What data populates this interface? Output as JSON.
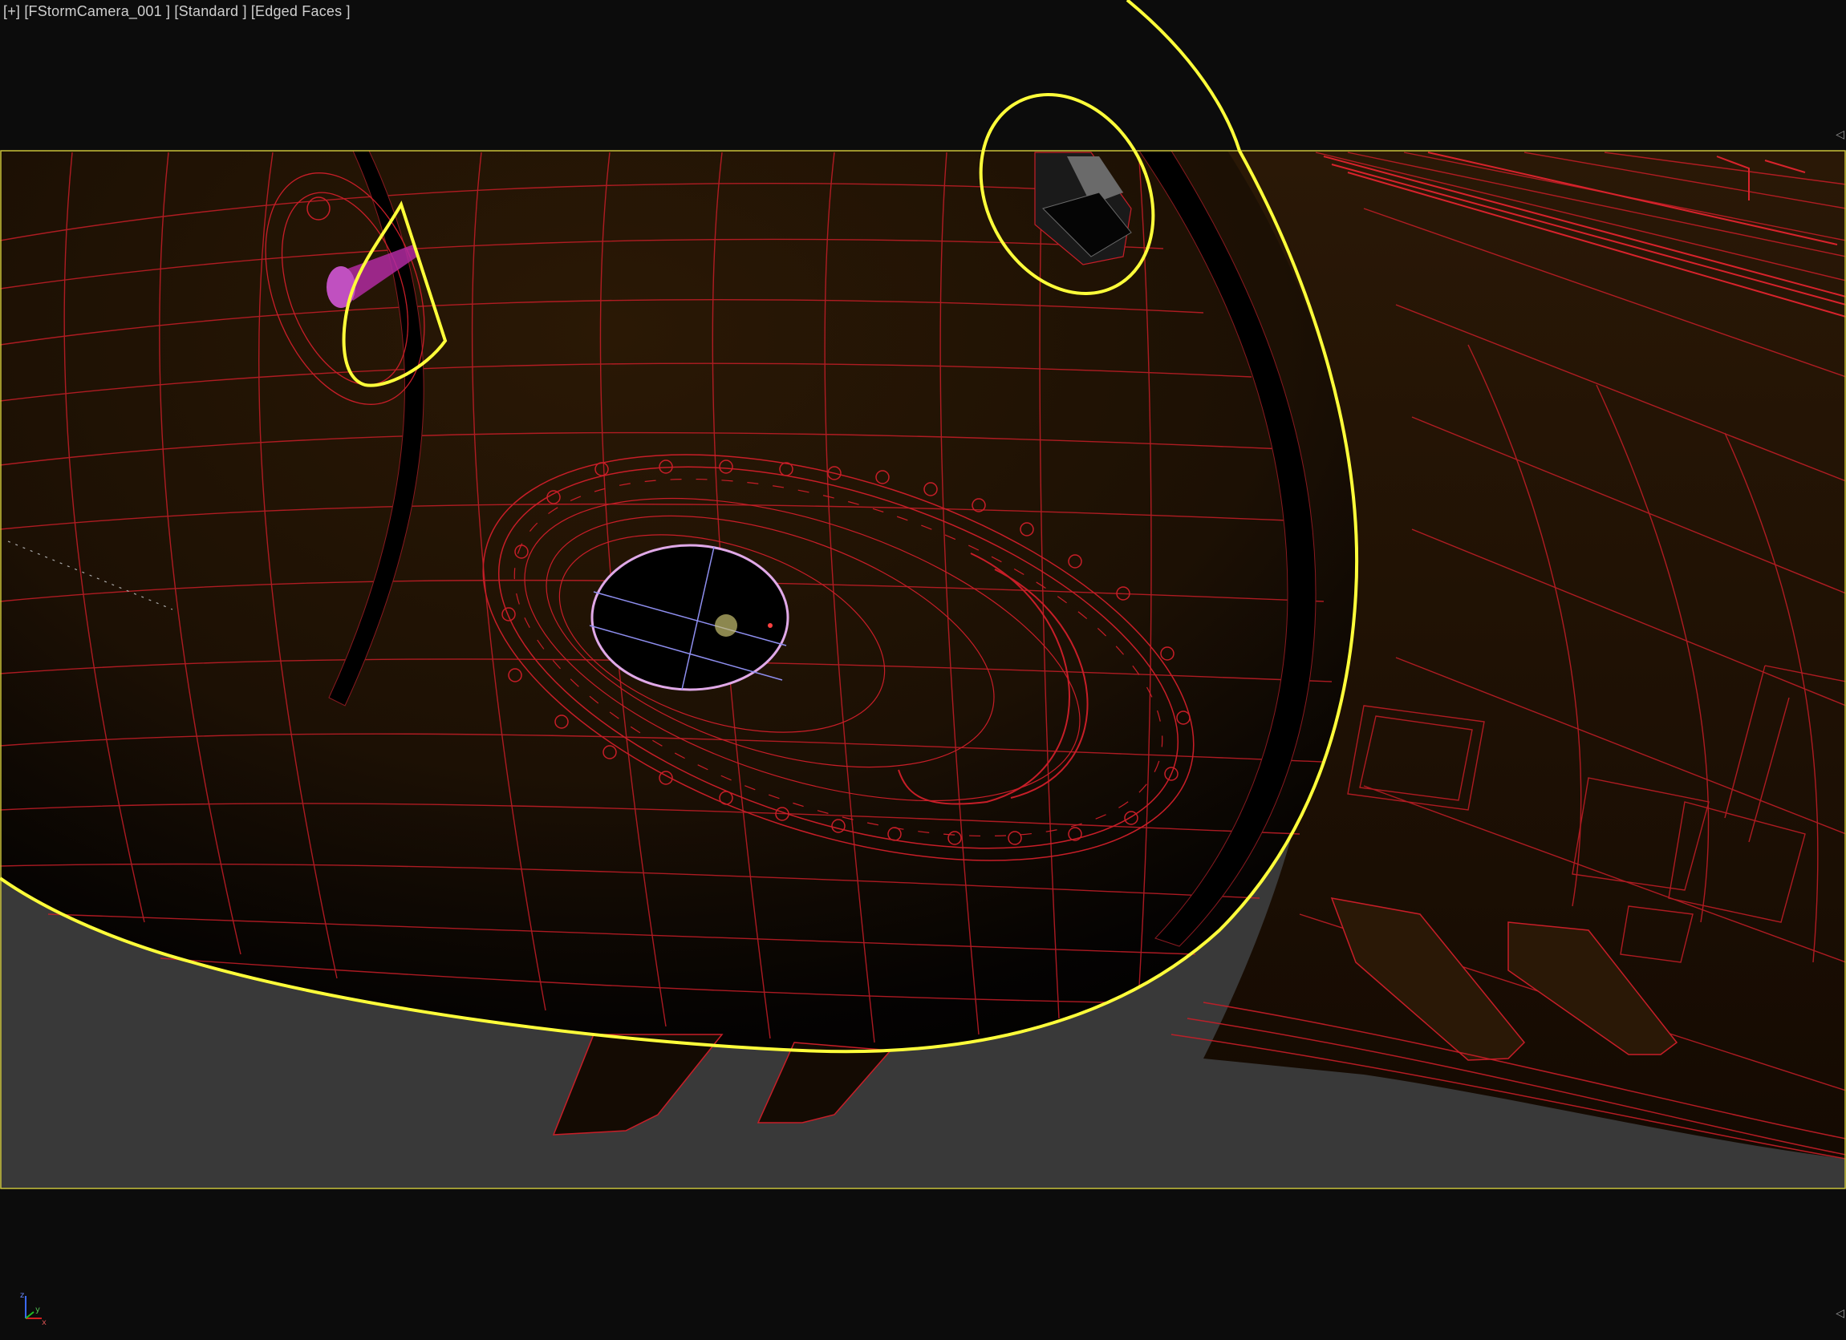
{
  "viewport": {
    "label": "[+] [FStormCamera_001 ] [Standard ] [Edged Faces ]",
    "camera_name": "FStormCamera_001",
    "shading_mode": "Standard",
    "display_mode": "Edged Faces"
  },
  "axis_gizmo": {
    "z": "z",
    "x": "x",
    "y": "y"
  },
  "colors": {
    "background": "#0c0c0c",
    "safe_frame": "#c9c23a",
    "wireframe": "#d0202a",
    "selection": "#ffff3a",
    "ground": "#3a3a3a",
    "hull_fill": "#231405"
  }
}
